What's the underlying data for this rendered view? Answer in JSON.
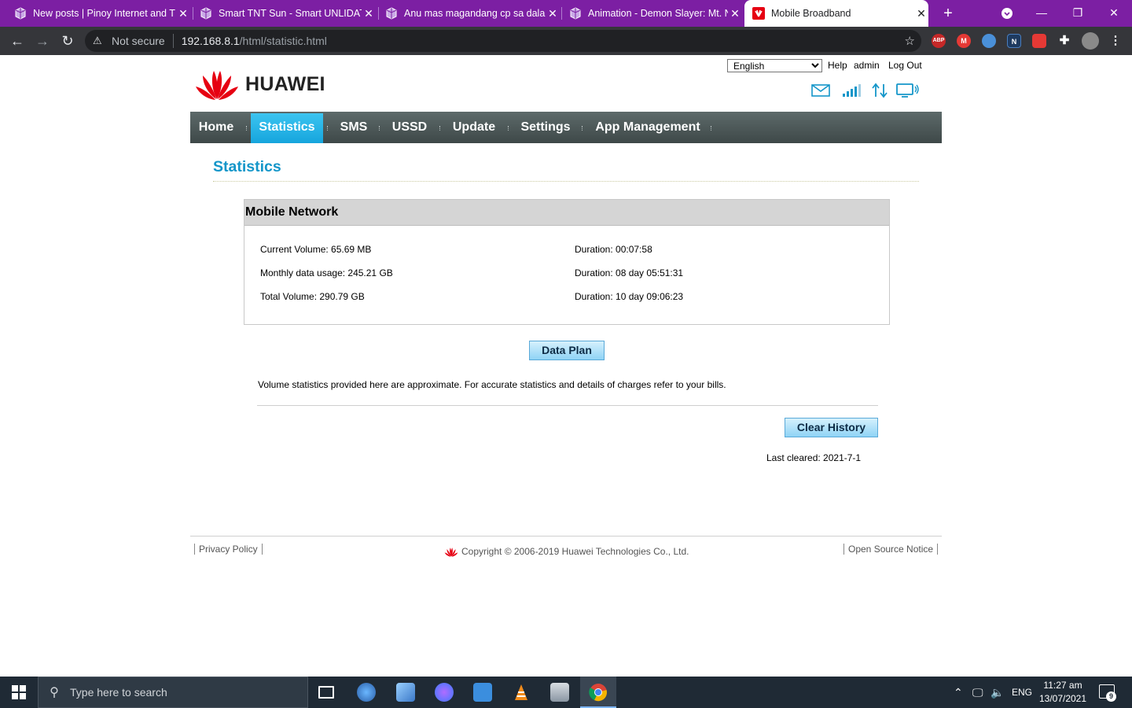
{
  "browser": {
    "tabs": [
      {
        "title": "New posts | Pinoy Internet and T",
        "active": false
      },
      {
        "title": "Smart TNT Sun - Smart UNLIDATA",
        "active": false
      },
      {
        "title": "Anu mas magandang cp sa dala",
        "active": false
      },
      {
        "title": "Animation - Demon Slayer: Mt. N",
        "active": false
      },
      {
        "title": "Mobile Broadband",
        "active": true
      }
    ],
    "address": {
      "security_label": "Not secure",
      "host": "192.168.8.1",
      "path": "/html/statistic.html"
    },
    "extensions": [
      "ABP",
      "M",
      "",
      "N",
      "",
      "",
      ""
    ]
  },
  "router": {
    "language": "English",
    "language_options": [
      "English"
    ],
    "help_label": "Help",
    "user_label": "admin",
    "logout_label": "Log Out",
    "brand": "HUAWEI",
    "brand_color": "#e60012",
    "nav": [
      "Home",
      "Statistics",
      "SMS",
      "USSD",
      "Update",
      "Settings",
      "App Management"
    ],
    "active_nav": "Statistics",
    "page_title": "Statistics",
    "panel": {
      "title": "Mobile Network",
      "rows": [
        {
          "volume": "Current Volume: 65.69 MB",
          "duration": "Duration: 00:07:58"
        },
        {
          "volume": "Monthly data usage: 245.21 GB",
          "duration": "Duration: 08 day 05:51:31"
        },
        {
          "volume": "Total Volume: 290.79 GB",
          "duration": "Duration: 10 day 09:06:23"
        }
      ]
    },
    "data_plan_label": "Data Plan",
    "note": "Volume statistics provided here are approximate. For accurate statistics and details of charges refer to your bills.",
    "clear_history_label": "Clear History",
    "last_cleared": "Last cleared: 2021-7-1",
    "footer": {
      "privacy": "Privacy Policy",
      "copyright": "Copyright © 2006-2019 Huawei Technologies Co., Ltd.",
      "open_source": "Open Source Notice"
    },
    "accent_color": "#1496c9"
  },
  "taskbar": {
    "search_placeholder": "Type here to search",
    "language": "ENG",
    "time": "11:27 am",
    "date": "13/07/2021",
    "notification_count": "9"
  }
}
